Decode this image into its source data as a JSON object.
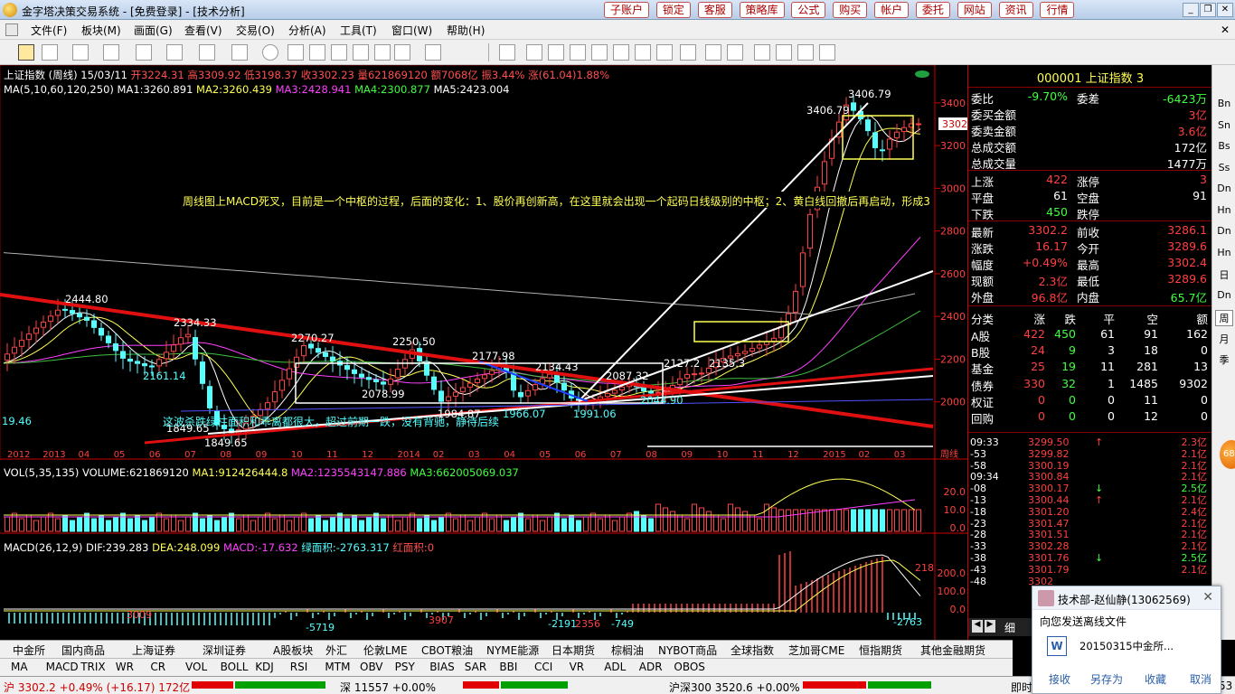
{
  "window": {
    "title": "金字塔决策交易系统 - [免费登录] - [技术分析]",
    "top_buttons": [
      "子账户",
      "锁定",
      "客服",
      "策略库",
      "公式",
      "购买",
      "帐户",
      "委托",
      "网站",
      "资讯",
      "行情"
    ],
    "menu": [
      "文件(F)",
      "板块(M)",
      "画面(G)",
      "查看(V)",
      "交易(O)",
      "分析(A)",
      "工具(T)",
      "窗口(W)",
      "帮助(H)"
    ]
  },
  "chart_info": {
    "line1": {
      "name": "上证指数 (周线)",
      "date": "15/03/11",
      "open": "开3224.31",
      "high": "高3309.92",
      "low": "低3198.37",
      "close": "收3302.23",
      "vol": "量621869120",
      "amount": "额7068亿",
      "amp": "振3.44%",
      "change": "涨(61.04)1.88%"
    },
    "line2": {
      "label": "MA(5,10,60,120,250)",
      "ma1": "MA1:3260.891",
      "ma2": "MA2:3260.439",
      "ma3": "MA3:2428.941",
      "ma4": "MA4:2300.877",
      "ma5": "MA5:2423.004"
    },
    "annotation1": "周线图上MACD死叉，目前是一个中枢的过程，后面的变化：1、股价再创新高，在这里就会出现一个起码日线级别的中枢；2、黄白线回撤后再启动，形成3",
    "annotation2": "这波杀跌绿柱面积和乖离都很大，超过前期一跌，没有背驰，静待后续",
    "price_labels": [
      "2444.80",
      "2334.33",
      "2161.14",
      "2270.27",
      "2078.99",
      "2250.50",
      "2177.98",
      "1984.87",
      "1966.07",
      "2134.43",
      "1991.06",
      "2087.32",
      "2044.90",
      "2127.2",
      "2135.3",
      "1849.65",
      "1849.65",
      "3406.79",
      "3406.79",
      "19.46"
    ],
    "current_price_tag": "3302",
    "y_axis_main": [
      "3400",
      "3200",
      "3000",
      "2800",
      "2600",
      "2400",
      "2200",
      "2000"
    ],
    "x_axis": [
      "2012",
      "2013",
      "04",
      "05",
      "06",
      "07",
      "08",
      "09",
      "10",
      "11",
      "12",
      "2014",
      "02",
      "03",
      "04",
      "05",
      "06",
      "07",
      "08",
      "09",
      "10",
      "11",
      "12",
      "2015",
      "02",
      "03"
    ],
    "period_label": "周线",
    "vol_info": {
      "label": "VOL(5,35,135)",
      "volume": "VOLUME:621869120",
      "ma1": "MA1:912426444.8",
      "ma2": "MA2:1235543147.886",
      "ma3": "MA3:662005069.037"
    },
    "vol_axis": [
      "20.0",
      "10.0",
      "0.0"
    ],
    "macd_info": {
      "label": "MACD(26,12,9)",
      "dif": "DIF:239.283",
      "dea": "DEA:248.099",
      "macd": "MACD:-17.632",
      "green": "绿面积:-2763.317",
      "red": "红面积:0"
    },
    "macd_axis": [
      "200.0",
      "100.0",
      "0.0"
    ],
    "macd_labels": [
      "3009",
      "-5719",
      "3907",
      "-2191",
      "2356",
      "-749",
      "218",
      "-2763"
    ]
  },
  "quote": {
    "code": "000001",
    "name": "上证指数",
    "num": "3",
    "rows": [
      [
        "委比",
        "-9.70%",
        "委差",
        "-6423万"
      ],
      [
        "委买金额",
        "",
        "",
        "3亿"
      ],
      [
        "委卖金额",
        "",
        "",
        "3.6亿"
      ],
      [
        "总成交额",
        "",
        "",
        "172亿"
      ],
      [
        "总成交量",
        "",
        "",
        "1477万"
      ],
      [
        "上涨",
        "422",
        "涨停",
        "3"
      ],
      [
        "平盘",
        "61",
        "空盘",
        "91"
      ],
      [
        "下跌",
        "450",
        "跌停",
        ""
      ],
      [
        "最新",
        "3302.2",
        "前收",
        "3286.1"
      ],
      [
        "涨跌",
        "16.17",
        "今开",
        "3289.6"
      ],
      [
        "幅度",
        "+0.49%",
        "最高",
        "3302.4"
      ],
      [
        "现额",
        "2.3亿",
        "最低",
        "3289.6"
      ],
      [
        "外盘",
        "96.8亿",
        "内盘",
        "65.7亿"
      ]
    ],
    "class_header": [
      "分类",
      "涨",
      "跌",
      "平",
      "空",
      "额"
    ],
    "class_rows": [
      [
        "A股",
        "422",
        "450",
        "61",
        "91",
        "162"
      ],
      [
        "B股",
        "24",
        "9",
        "3",
        "18",
        "0"
      ],
      [
        "基金",
        "25",
        "19",
        "11",
        "281",
        "13"
      ],
      [
        "债券",
        "330",
        "32",
        "1",
        "1485",
        "9302"
      ],
      [
        "权证",
        "0",
        "0",
        "0",
        "11",
        "0"
      ],
      [
        "回购",
        "0",
        "0",
        "0",
        "12",
        "0"
      ]
    ]
  },
  "ticks": [
    [
      "09:33",
      "3299.50",
      "↑",
      "2.3亿"
    ],
    [
      "-53",
      "3299.82",
      "",
      "2.1亿"
    ],
    [
      "-58",
      "3300.19",
      "",
      "2.1亿"
    ],
    [
      "09:34",
      "3300.84",
      "",
      "2.1亿"
    ],
    [
      "-08",
      "3300.17",
      "↓",
      "2.5亿"
    ],
    [
      "-13",
      "3300.44",
      "↑",
      "2.1亿"
    ],
    [
      "-18",
      "3301.20",
      "",
      "2.4亿"
    ],
    [
      "-23",
      "3301.47",
      "",
      "2.1亿"
    ],
    [
      "-28",
      "3301.51",
      "",
      "2.1亿"
    ],
    [
      "-33",
      "3302.28",
      "",
      "2.1亿"
    ],
    [
      "-38",
      "3301.76",
      "↓",
      "2.5亿"
    ],
    [
      "-43",
      "3301.79",
      "",
      "2.1亿"
    ],
    [
      "-48",
      "3302",
      "",
      ""
    ]
  ],
  "ticks_bottom_tab": "细",
  "sidebar": [
    "Bn",
    "Sn",
    "Bs",
    "Ss",
    "Dn",
    "Hn",
    "Dn",
    "Hn",
    "日",
    "Dn",
    "周",
    "月",
    "季"
  ],
  "tabs1": [
    "中金所",
    "国内商品",
    "上海证券",
    "深圳证券",
    "A股板块",
    "外汇",
    "伦敦LME",
    "CBOT粮油",
    "NYME能源",
    "日本期货",
    "棕榈油",
    "NYBOT商品",
    "全球指数",
    "芝加哥CME",
    "恒指期货",
    "其他金融期货"
  ],
  "tabs2": [
    "MA",
    "MACD",
    "TRIX",
    "WR",
    "CR",
    "VOL",
    "BOLL",
    "KDJ",
    "RSI",
    "MTM",
    "OBV",
    "PSY",
    "BIAS",
    "SAR",
    "BBI",
    "CCI",
    "VR",
    "ADL",
    "ADR",
    "OBOS"
  ],
  "status": {
    "sh": "沪 3302.2 +0.49% (+16.17) 172亿",
    "sz": "深 11557 +0.00%",
    "hs300": "沪深300   3520.6 +0.00%",
    "right": "即时",
    "time": "53"
  },
  "popup": {
    "name": "技术部-赵仙静(13062569)",
    "message": "向您发送离线文件",
    "file": "20150315中金所...",
    "actions": [
      "接收",
      "另存为",
      "收藏",
      "取消"
    ]
  },
  "orange_badge": "68",
  "colors": {
    "up": "#ff4040",
    "down": "#54ffff",
    "yellow": "#ffff54",
    "white": "#ffffff",
    "magenta": "#ff40ff",
    "green": "#40c040"
  }
}
